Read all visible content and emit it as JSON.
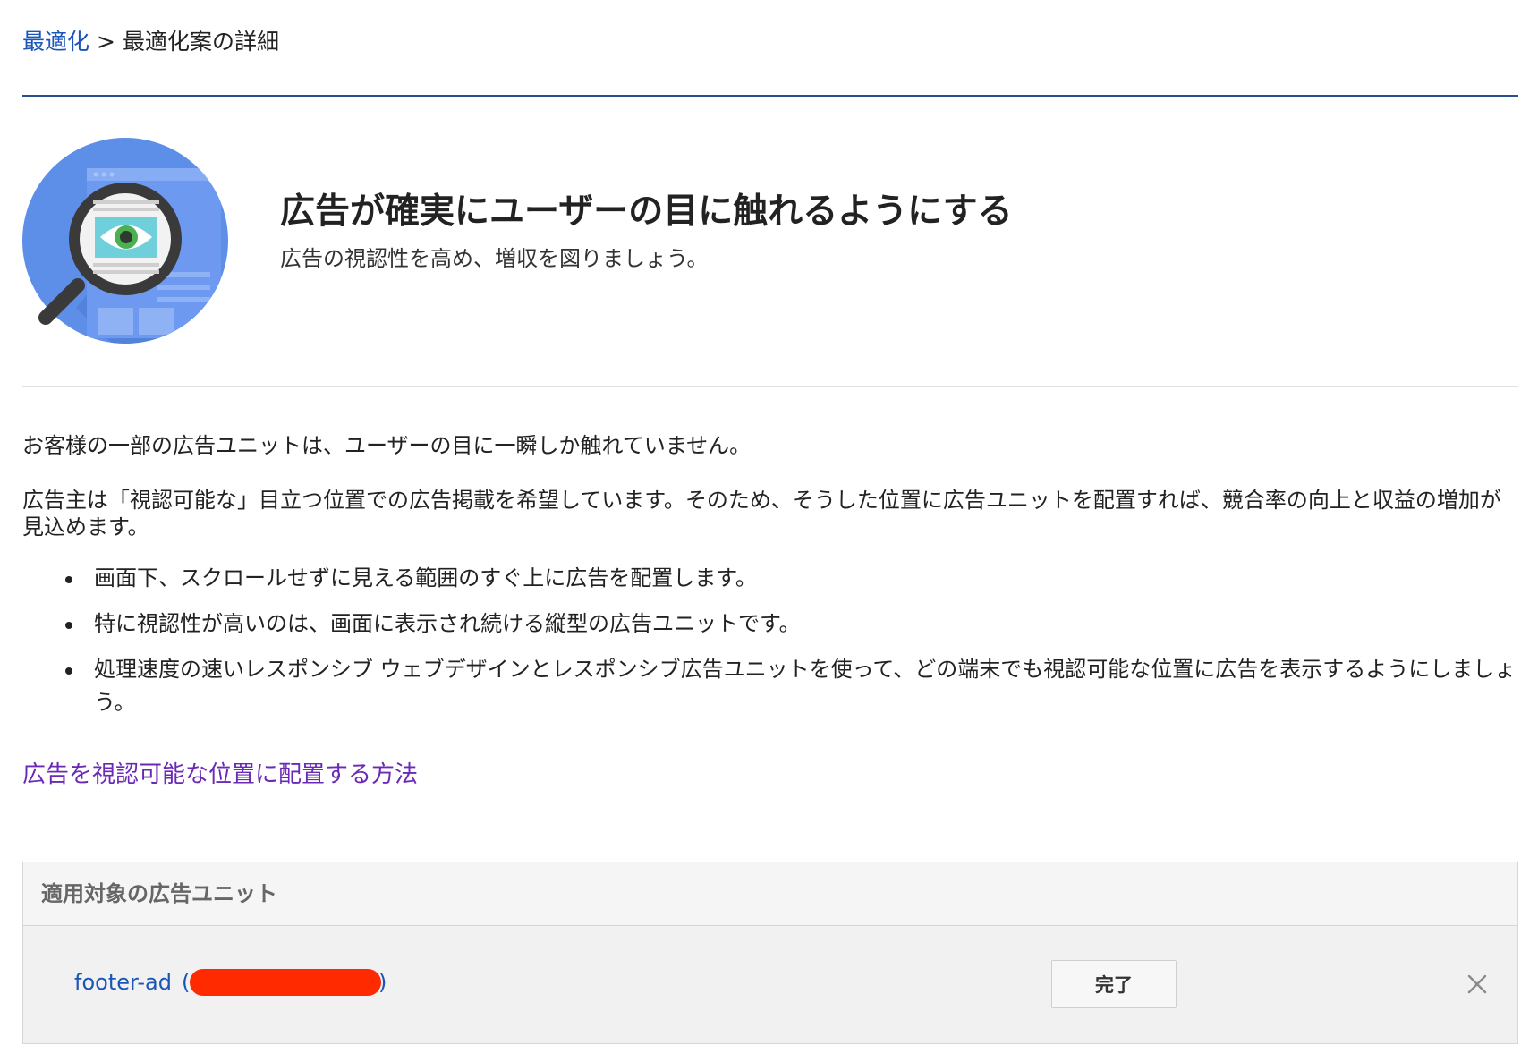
{
  "breadcrumb": {
    "parent": "最適化",
    "separator": ">",
    "current": "最適化案の詳細"
  },
  "hero": {
    "icon": "magnifier-eye-icon",
    "title": "広告が確実にユーザーの目に触れるようにする",
    "subtitle": "広告の視認性を高め、増収を図りましょう。"
  },
  "body": {
    "para1": "お客様の一部の広告ユニットは、ユーザーの目に一瞬しか触れていません。",
    "para2": "広告主は「視認可能な」目立つ位置での広告掲載を希望しています。そのため、そうした位置に広告ユニットを配置すれば、競合率の向上と収益の増加が見込めます。",
    "bullets": [
      "画面下、スクロールせずに見える範囲のすぐ上に広告を配置します。",
      "特に視認性が高いのは、画面に表示され続ける縦型の広告ユニットです。",
      "処理速度の速いレスポンシブ ウェブデザインとレスポンシブ広告ユニットを使って、どの端末でも視認可能な位置に広告を表示するようにしましょう。"
    ],
    "help_link": "広告を視認可能な位置に配置する方法"
  },
  "units_panel": {
    "title": "適用対象の広告ユニット",
    "units": [
      {
        "name": "footer-ad",
        "paren_open": "(",
        "paren_close": ")",
        "done_label": "完了",
        "close_icon": "close-icon"
      }
    ]
  },
  "colors": {
    "link": "#1a55b8",
    "visited_link": "#6a2ab6",
    "rule": "#2a4f8f",
    "redaction": "#ff2a00"
  }
}
